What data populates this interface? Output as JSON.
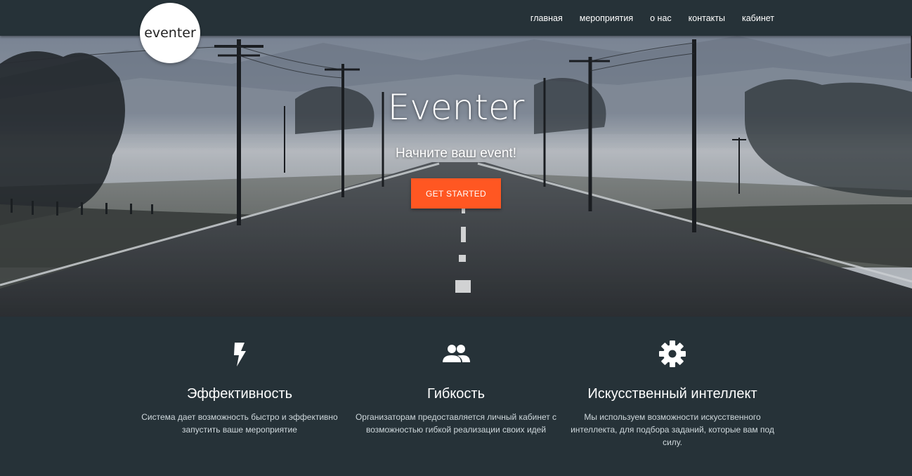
{
  "brand": {
    "logo_text": "eventer"
  },
  "nav": {
    "items": [
      {
        "label": "главная"
      },
      {
        "label": "мероприятия"
      },
      {
        "label": "о нас"
      },
      {
        "label": "контакты"
      },
      {
        "label": "кабинет"
      }
    ]
  },
  "hero": {
    "title": "Eventer",
    "subtitle": "Начните ваш event!",
    "cta_label": "GET STARTED"
  },
  "features": [
    {
      "icon": "lightning-bolt-icon",
      "title": "Эффективность",
      "text": "Система дает возможность быстро и эффективно запустить ваше мероприятие"
    },
    {
      "icon": "people-group-icon",
      "title": "Гибкость",
      "text": "Организаторам предоставляется личный кабинет с возможностью гибкой реализации своих идей"
    },
    {
      "icon": "gear-icon",
      "title": "Искусственный интеллект",
      "text": "Мы используем возможности искусственного интеллекта, для подбора заданий, которые вам под силу."
    }
  ],
  "colors": {
    "navbar_bg": "#263238",
    "accent": "#ff5722",
    "text_light": "#ffffff",
    "text_muted": "#cfd8dc"
  }
}
